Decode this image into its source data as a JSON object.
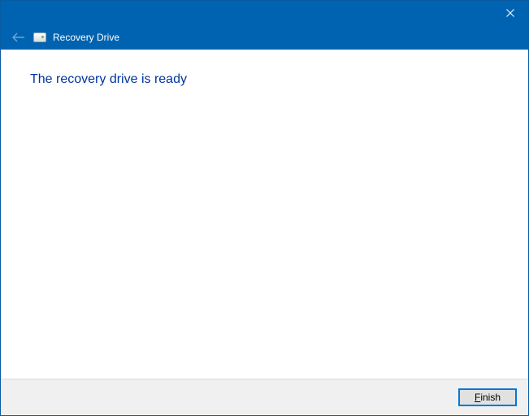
{
  "header": {
    "title": "Recovery Drive"
  },
  "content": {
    "headline": "The recovery drive is ready"
  },
  "footer": {
    "finish_first_letter": "F",
    "finish_rest": "inish"
  }
}
